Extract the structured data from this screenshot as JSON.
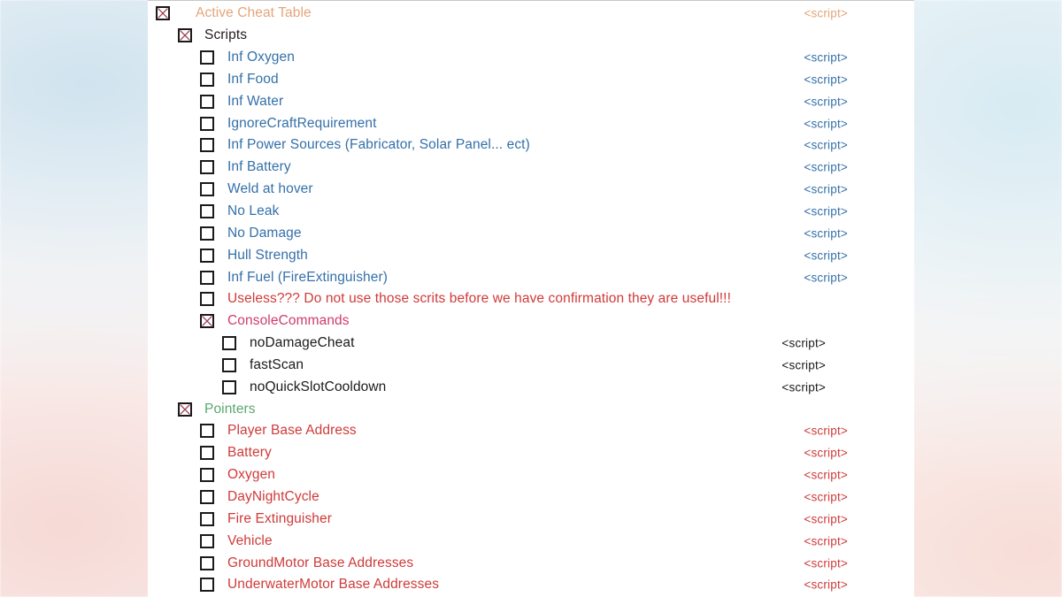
{
  "palette": {
    "orange": "#e3a579",
    "blue": "#3470a8",
    "red": "#d03a3a",
    "crimson": "#cf3b6f",
    "green": "#5aa86e",
    "black": "#1a1a1a",
    "dark": "#241a22",
    "panel_bg": "#ffffff"
  },
  "script_label": "<script>",
  "tree": {
    "rows": [
      {
        "name": "root-active-cheat-table",
        "label": "Active Cheat Table",
        "level": 0,
        "checked": true,
        "color": "orange",
        "script": true,
        "script_color": "orange"
      },
      {
        "name": "group-scripts",
        "label": "Scripts",
        "level": 1,
        "checked": true,
        "color": "dark",
        "script": false,
        "script_color": "blue"
      },
      {
        "name": "item-inf-oxygen",
        "label": "Inf Oxygen",
        "level": 2,
        "checked": false,
        "color": "blue",
        "script": true,
        "script_color": "blue"
      },
      {
        "name": "item-inf-food",
        "label": "Inf Food",
        "level": 2,
        "checked": false,
        "color": "blue",
        "script": true,
        "script_color": "blue"
      },
      {
        "name": "item-inf-water",
        "label": "Inf Water",
        "level": 2,
        "checked": false,
        "color": "blue",
        "script": true,
        "script_color": "blue"
      },
      {
        "name": "item-ignore-craft-requirement",
        "label": "IgnoreCraftRequirement",
        "level": 2,
        "checked": false,
        "color": "blue",
        "script": true,
        "script_color": "blue"
      },
      {
        "name": "item-inf-power-sources",
        "label": "Inf Power Sources (Fabricator, Solar Panel... ect)",
        "level": 2,
        "checked": false,
        "color": "blue",
        "script": true,
        "script_color": "blue"
      },
      {
        "name": "item-inf-battery",
        "label": "Inf Battery",
        "level": 2,
        "checked": false,
        "color": "blue",
        "script": true,
        "script_color": "blue"
      },
      {
        "name": "item-weld-at-hover",
        "label": "Weld at hover",
        "level": 2,
        "checked": false,
        "color": "blue",
        "script": true,
        "script_color": "blue"
      },
      {
        "name": "item-no-leak",
        "label": "No Leak",
        "level": 2,
        "checked": false,
        "color": "blue",
        "script": true,
        "script_color": "blue"
      },
      {
        "name": "item-no-damage",
        "label": "No Damage",
        "level": 2,
        "checked": false,
        "color": "blue",
        "script": true,
        "script_color": "blue"
      },
      {
        "name": "item-hull-strength",
        "label": "Hull Strength",
        "level": 2,
        "checked": false,
        "color": "blue",
        "script": true,
        "script_color": "blue"
      },
      {
        "name": "item-inf-fuel",
        "label": "Inf Fuel (FireExtinguisher)",
        "level": 2,
        "checked": false,
        "color": "blue",
        "script": true,
        "script_color": "blue"
      },
      {
        "name": "item-useless-warning",
        "label": "Useless??? Do not use those scrits before we have confirmation they are useful!!!",
        "level": 2,
        "checked": false,
        "color": "red",
        "script": false,
        "script_color": "red"
      },
      {
        "name": "group-console-commands",
        "label": "ConsoleCommands",
        "level": 2,
        "checked": true,
        "color": "crimson",
        "script": false,
        "script_color": "black"
      },
      {
        "name": "item-no-damage-cheat",
        "label": "noDamageCheat",
        "level": 3,
        "checked": false,
        "color": "black",
        "script": true,
        "script_color": "black"
      },
      {
        "name": "item-fast-scan",
        "label": "fastScan",
        "level": 3,
        "checked": false,
        "color": "black",
        "script": true,
        "script_color": "black"
      },
      {
        "name": "item-no-quick-slot-cooldown",
        "label": "noQuickSlotCooldown",
        "level": 3,
        "checked": false,
        "color": "black",
        "script": true,
        "script_color": "black"
      },
      {
        "name": "group-pointers",
        "label": "Pointers",
        "level": 1,
        "checked": true,
        "color": "green",
        "script": false,
        "script_color": "red"
      },
      {
        "name": "item-player-base-address",
        "label": "Player Base Address",
        "level": 2,
        "checked": false,
        "color": "red",
        "script": true,
        "script_color": "red"
      },
      {
        "name": "item-battery",
        "label": "Battery",
        "level": 2,
        "checked": false,
        "color": "red",
        "script": true,
        "script_color": "red"
      },
      {
        "name": "item-oxygen",
        "label": "Oxygen",
        "level": 2,
        "checked": false,
        "color": "red",
        "script": true,
        "script_color": "red"
      },
      {
        "name": "item-day-night-cycle",
        "label": "DayNightCycle",
        "level": 2,
        "checked": false,
        "color": "red",
        "script": true,
        "script_color": "red"
      },
      {
        "name": "item-fire-extinguisher",
        "label": "Fire Extinguisher",
        "level": 2,
        "checked": false,
        "color": "red",
        "script": true,
        "script_color": "red"
      },
      {
        "name": "item-vehicle",
        "label": "Vehicle",
        "level": 2,
        "checked": false,
        "color": "red",
        "script": true,
        "script_color": "red"
      },
      {
        "name": "item-ground-motor-base-addresses",
        "label": "GroundMotor Base Addresses",
        "level": 2,
        "checked": false,
        "color": "red",
        "script": true,
        "script_color": "red"
      },
      {
        "name": "item-underwater-motor-base-addresses",
        "label": "UnderwaterMotor Base Addresses",
        "level": 2,
        "checked": false,
        "color": "red",
        "script": true,
        "script_color": "red"
      }
    ]
  }
}
